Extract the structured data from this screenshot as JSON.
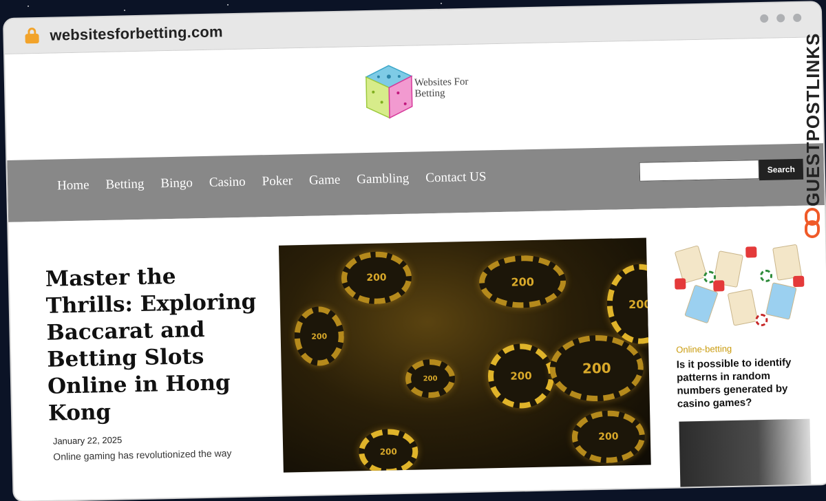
{
  "browser": {
    "url": "websitesforbetting.com"
  },
  "site": {
    "logo_line1": "Websites For",
    "logo_line2": "Betting"
  },
  "nav": {
    "items": [
      "Home",
      "Betting",
      "Bingo",
      "Casino",
      "Poker",
      "Game",
      "Gambling",
      "Contact US"
    ]
  },
  "search": {
    "button_label": "Search",
    "placeholder": ""
  },
  "post": {
    "title": "Master the Thrills: Exploring Baccarat and Betting Slots Online in Hong Kong",
    "date": "January 22, 2025",
    "excerpt": "Online gaming has revolutionized the way"
  },
  "sidebar": {
    "category": "Online-betting",
    "title": "Is it possible to identify patterns in random numbers generated by casino games?"
  },
  "brand": {
    "vertical_label": "GUESTPOSTLINKS"
  },
  "hero": {
    "chip_value": "200"
  }
}
